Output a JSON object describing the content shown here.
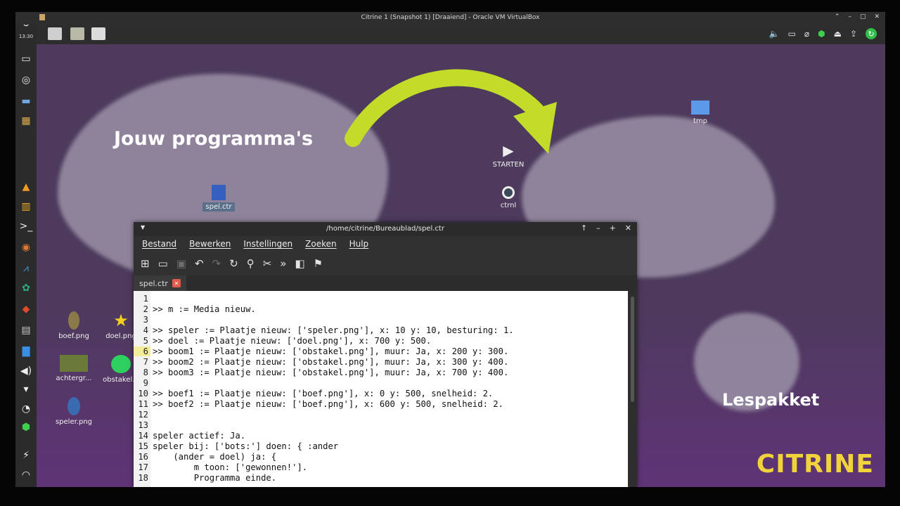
{
  "vbox": {
    "title": "Citrine 1 (Snapshot 1) [Draaiend] - Oracle VM VirtualBox",
    "controls": [
      "⌃",
      "–",
      "▢",
      "✕"
    ]
  },
  "dock": {
    "clock": "13:30"
  },
  "desktop": {
    "heading": "Jouw programma's",
    "subheading": "Lespakket",
    "brand": "CITRINE",
    "icons": {
      "spel": "spel.ctr",
      "starten": "STARTEN",
      "ctrnl": "ctrnl",
      "tmp": "tmp",
      "boef": "boef.png",
      "doel": "doel.png",
      "achtergrond": "achtergr...",
      "obstakel": "obstakel...",
      "speler": "speler.png"
    }
  },
  "editor": {
    "title": "/home/citrine/Bureaublad/spel.ctr",
    "menu": [
      "Bestand",
      "Bewerken",
      "Instellingen",
      "Zoeken",
      "Hulp"
    ],
    "tab": "spel.ctr",
    "current_line": 6,
    "lines": [
      {
        "n": "1",
        "text": ""
      },
      {
        "n": "2",
        "text": ">> m := Media nieuw."
      },
      {
        "n": "3",
        "text": ""
      },
      {
        "n": "4",
        "text": ">> speler := Plaatje nieuw: ['speler.png'], x: 10 y: 10, besturing: 1."
      },
      {
        "n": "5",
        "text": ">> doel := Plaatje nieuw: ['doel.png'], x: 700 y: 500."
      },
      {
        "n": "6",
        "text": ">> boom1 := Plaatje nieuw: ['obstakel.png'], muur: Ja, x: 200 y: 300."
      },
      {
        "n": "7",
        "text": ">> boom2 := Plaatje nieuw: ['obstakel.png'], muur: Ja, x: 300 y: 400."
      },
      {
        "n": "8",
        "text": ">> boom3 := Plaatje nieuw: ['obstakel.png'], muur: Ja, x: 700 y: 400."
      },
      {
        "n": "9",
        "text": ""
      },
      {
        "n": "10",
        "text": ">> boef1 := Plaatje nieuw: ['boef.png'], x: 0 y: 500, snelheid: 2."
      },
      {
        "n": "11",
        "text": ">> boef2 := Plaatje nieuw: ['boef.png'], x: 600 y: 500, snelheid: 2."
      },
      {
        "n": "12",
        "text": ""
      },
      {
        "n": "13",
        "text": ""
      },
      {
        "n": "14",
        "text": "speler actief: Ja."
      },
      {
        "n": "15",
        "text": "speler bij: ['bots:'] doen: { :ander"
      },
      {
        "n": "16",
        "text": "    (ander = doel) ja: {"
      },
      {
        "n": "17",
        "text": "        m toon: ['gewonnen!']."
      },
      {
        "n": "18",
        "text": "        Programma einde."
      }
    ]
  }
}
